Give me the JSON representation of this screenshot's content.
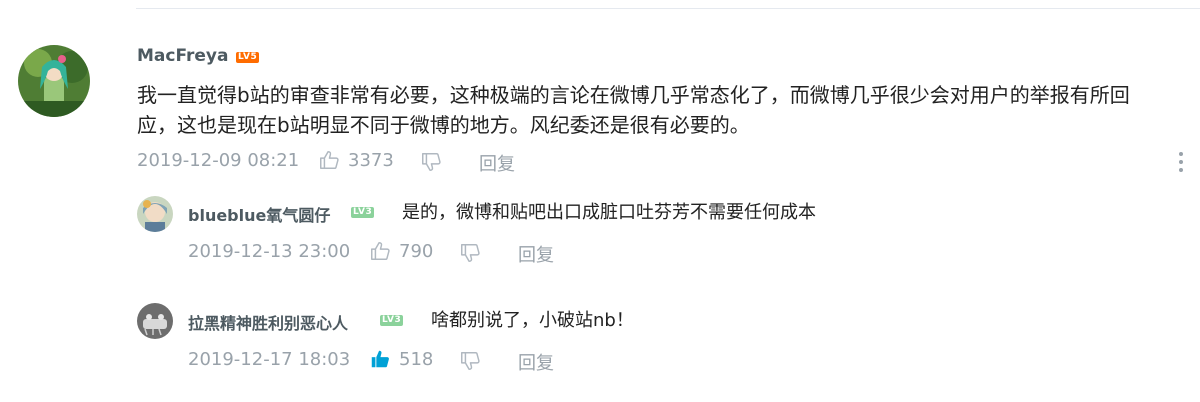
{
  "main_comment": {
    "username": "MacFreya",
    "level": "LV5",
    "text_line1": "我一直觉得b站的审查非常有必要，这种极端的言论在微博几乎常态化了，而微博几乎很少会对用户的举报有所回",
    "text_line2": "应，这也是现在b站明显不同于微博的地方。风纪委还是很有必要的。",
    "time": "2019-12-09 08:21",
    "likes": "3373",
    "reply_label": "回复"
  },
  "replies": [
    {
      "username": "blueblue氧气圆仔",
      "level": "LV3",
      "text": "是的，微博和贴吧出口成脏口吐芬芳不需要任何成本",
      "time": "2019-12-13 23:00",
      "likes": "790",
      "liked": false,
      "reply_label": "回复"
    },
    {
      "username": "拉黑精神胜利别恶心人",
      "level": "LV3",
      "text": "啥都别说了，小破站nb！",
      "time": "2019-12-17 18:03",
      "likes": "518",
      "liked": true,
      "reply_label": "回复"
    }
  ],
  "colors": {
    "meta_text": "#99a2aa",
    "liked_icon": "#00a1d6",
    "level5_badge": "#ff6c00",
    "level3_badge": "#8bd29b"
  },
  "icons": [
    "thumbs-up-icon",
    "thumbs-down-icon",
    "more-menu-icon"
  ]
}
